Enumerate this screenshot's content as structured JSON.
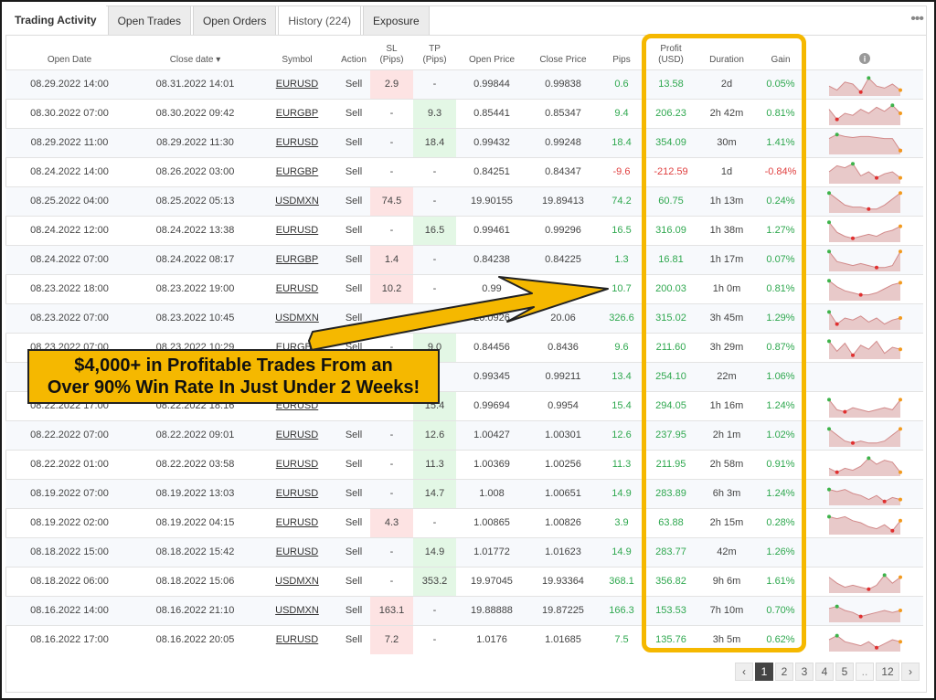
{
  "tabs": {
    "title": "Trading Activity",
    "items": [
      "Open Trades",
      "Open Orders",
      "History (224)",
      "Exposure"
    ],
    "more": "•••"
  },
  "columns": {
    "open_date": "Open Date",
    "close_date": "Close date ▾",
    "symbol": "Symbol",
    "action": "Action",
    "sl_1": "SL",
    "sl_2": "(Pips)",
    "tp_1": "TP",
    "tp_2": "(Pips)",
    "open_price": "Open Price",
    "close_price": "Close Price",
    "pips": "Pips",
    "profit_1": "Profit",
    "profit_2": "(USD)",
    "duration": "Duration",
    "gain": "Gain",
    "info_icon": "i"
  },
  "rows": [
    {
      "open": "08.29.2022 14:00",
      "close": "08.31.2022 14:01",
      "symbol": "EURUSD",
      "action": "Sell",
      "sl": "2.9",
      "tp": "-",
      "open_price": "0.99844",
      "close_price": "0.99838",
      "pips": "0.6",
      "profit": "13.58",
      "duration": "2d",
      "gain": "0.05%"
    },
    {
      "open": "08.30.2022 07:00",
      "close": "08.30.2022 09:42",
      "symbol": "EURGBP",
      "action": "Sell",
      "sl": "-",
      "tp": "9.3",
      "open_price": "0.85441",
      "close_price": "0.85347",
      "pips": "9.4",
      "profit": "206.23",
      "duration": "2h 42m",
      "gain": "0.81%"
    },
    {
      "open": "08.29.2022 11:00",
      "close": "08.29.2022 11:30",
      "symbol": "EURUSD",
      "action": "Sell",
      "sl": "-",
      "tp": "18.4",
      "open_price": "0.99432",
      "close_price": "0.99248",
      "pips": "18.4",
      "profit": "354.09",
      "duration": "30m",
      "gain": "1.41%"
    },
    {
      "open": "08.24.2022 14:00",
      "close": "08.26.2022 03:00",
      "symbol": "EURGBP",
      "action": "Sell",
      "sl": "-",
      "tp": "-",
      "open_price": "0.84251",
      "close_price": "0.84347",
      "pips": "-9.6",
      "profit": "-212.59",
      "duration": "1d",
      "gain": "-0.84%"
    },
    {
      "open": "08.25.2022 04:00",
      "close": "08.25.2022 05:13",
      "symbol": "USDMXN",
      "action": "Sell",
      "sl": "74.5",
      "tp": "-",
      "open_price": "19.90155",
      "close_price": "19.89413",
      "pips": "74.2",
      "profit": "60.75",
      "duration": "1h 13m",
      "gain": "0.24%"
    },
    {
      "open": "08.24.2022 12:00",
      "close": "08.24.2022 13:38",
      "symbol": "EURUSD",
      "action": "Sell",
      "sl": "-",
      "tp": "16.5",
      "open_price": "0.99461",
      "close_price": "0.99296",
      "pips": "16.5",
      "profit": "316.09",
      "duration": "1h 38m",
      "gain": "1.27%"
    },
    {
      "open": "08.24.2022 07:00",
      "close": "08.24.2022 08:17",
      "symbol": "EURGBP",
      "action": "Sell",
      "sl": "1.4",
      "tp": "-",
      "open_price": "0.84238",
      "close_price": "0.84225",
      "pips": "1.3",
      "profit": "16.81",
      "duration": "1h 17m",
      "gain": "0.07%"
    },
    {
      "open": "08.23.2022 18:00",
      "close": "08.23.2022 19:00",
      "symbol": "EURUSD",
      "action": "Sell",
      "sl": "10.2",
      "tp": "-",
      "open_price": "0.99",
      "close_price": "",
      "pips": "10.7",
      "profit": "200.03",
      "duration": "1h 0m",
      "gain": "0.81%"
    },
    {
      "open": "08.23.2022 07:00",
      "close": "08.23.2022 10:45",
      "symbol": "USDMXN",
      "action": "Sell",
      "sl": "",
      "tp": "",
      "open_price": "20.0926",
      "close_price": "20.06",
      "pips": "326.6",
      "profit": "315.02",
      "duration": "3h 45m",
      "gain": "1.29%"
    },
    {
      "open": "08.23.2022 07:00",
      "close": "08.23.2022 10:29",
      "symbol": "EURGBP",
      "action": "Sell",
      "sl": "-",
      "tp": "9.0",
      "open_price": "0.84456",
      "close_price": "0.8436",
      "pips": "9.6",
      "profit": "211.60",
      "duration": "3h 29m",
      "gain": "0.87%"
    },
    {
      "open": "",
      "close": "",
      "symbol": "",
      "action": "",
      "sl": "",
      "tp": "",
      "open_price": "0.99345",
      "close_price": "0.99211",
      "pips": "13.4",
      "profit": "254.10",
      "duration": "22m",
      "gain": "1.06%"
    },
    {
      "open": "08.22.2022 17:00",
      "close": "08.22.2022 18:16",
      "symbol": "EURUSD",
      "action": "",
      "sl": "",
      "tp": "15.4",
      "open_price": "0.99694",
      "close_price": "0.9954",
      "pips": "15.4",
      "profit": "294.05",
      "duration": "1h 16m",
      "gain": "1.24%"
    },
    {
      "open": "08.22.2022 07:00",
      "close": "08.22.2022 09:01",
      "symbol": "EURUSD",
      "action": "Sell",
      "sl": "-",
      "tp": "12.6",
      "open_price": "1.00427",
      "close_price": "1.00301",
      "pips": "12.6",
      "profit": "237.95",
      "duration": "2h 1m",
      "gain": "1.02%"
    },
    {
      "open": "08.22.2022 01:00",
      "close": "08.22.2022 03:58",
      "symbol": "EURUSD",
      "action": "Sell",
      "sl": "-",
      "tp": "11.3",
      "open_price": "1.00369",
      "close_price": "1.00256",
      "pips": "11.3",
      "profit": "211.95",
      "duration": "2h 58m",
      "gain": "0.91%"
    },
    {
      "open": "08.19.2022 07:00",
      "close": "08.19.2022 13:03",
      "symbol": "EURUSD",
      "action": "Sell",
      "sl": "-",
      "tp": "14.7",
      "open_price": "1.008",
      "close_price": "1.00651",
      "pips": "14.9",
      "profit": "283.89",
      "duration": "6h 3m",
      "gain": "1.24%"
    },
    {
      "open": "08.19.2022 02:00",
      "close": "08.19.2022 04:15",
      "symbol": "EURUSD",
      "action": "Sell",
      "sl": "4.3",
      "tp": "-",
      "open_price": "1.00865",
      "close_price": "1.00826",
      "pips": "3.9",
      "profit": "63.88",
      "duration": "2h 15m",
      "gain": "0.28%"
    },
    {
      "open": "08.18.2022 15:00",
      "close": "08.18.2022 15:42",
      "symbol": "EURUSD",
      "action": "Sell",
      "sl": "-",
      "tp": "14.9",
      "open_price": "1.01772",
      "close_price": "1.01623",
      "pips": "14.9",
      "profit": "283.77",
      "duration": "42m",
      "gain": "1.26%"
    },
    {
      "open": "08.18.2022 06:00",
      "close": "08.18.2022 15:06",
      "symbol": "USDMXN",
      "action": "Sell",
      "sl": "-",
      "tp": "353.2",
      "open_price": "19.97045",
      "close_price": "19.93364",
      "pips": "368.1",
      "profit": "356.82",
      "duration": "9h 6m",
      "gain": "1.61%"
    },
    {
      "open": "08.16.2022 14:00",
      "close": "08.16.2022 21:10",
      "symbol": "USDMXN",
      "action": "Sell",
      "sl": "163.1",
      "tp": "-",
      "open_price": "19.88888",
      "close_price": "19.87225",
      "pips": "166.3",
      "profit": "153.53",
      "duration": "7h 10m",
      "gain": "0.70%"
    },
    {
      "open": "08.16.2022 17:00",
      "close": "08.16.2022 20:05",
      "symbol": "EURUSD",
      "action": "Sell",
      "sl": "7.2",
      "tp": "-",
      "open_price": "1.0176",
      "close_price": "1.01685",
      "pips": "7.5",
      "profit": "135.76",
      "duration": "3h 5m",
      "gain": "0.62%"
    }
  ],
  "callout": {
    "line1": "$4,000+ in Profitable Trades From an",
    "line2": "Over 90% Win Rate In Just Under 2 Weeks!"
  },
  "pagination": {
    "prev": "‹",
    "pages": [
      "1",
      "2",
      "3",
      "4",
      "5"
    ],
    "ellipsis": "..",
    "last": "12",
    "next": "›"
  },
  "colors": {
    "profit_green": "#2fa84f",
    "loss_red": "#e04040",
    "highlight_yellow": "#f5b800"
  }
}
